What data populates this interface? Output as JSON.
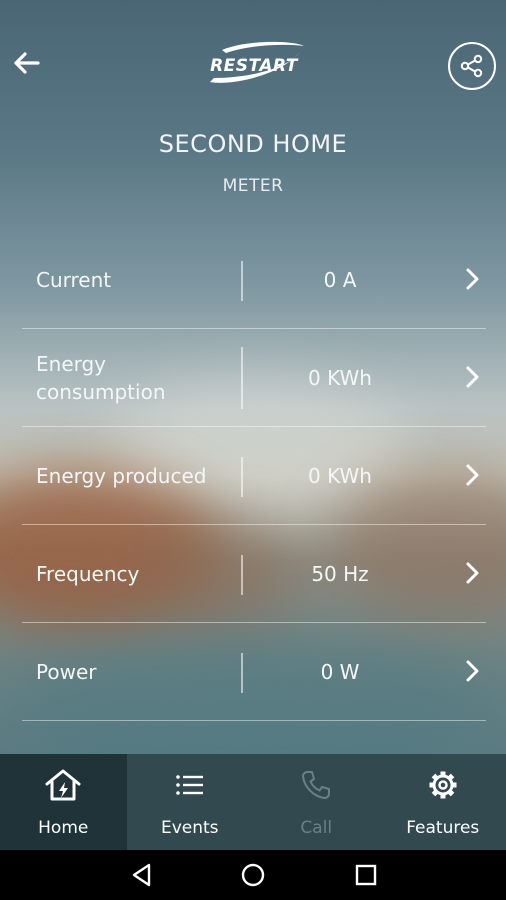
{
  "header": {
    "logo_text": "ReStart",
    "title": "SECOND HOME",
    "subtitle": "METER"
  },
  "rows": [
    {
      "label": "Current",
      "value": "0 A"
    },
    {
      "label": "Energy consumption",
      "value": "0 KWh"
    },
    {
      "label": "Energy produced",
      "value": "0 KWh"
    },
    {
      "label": "Frequency",
      "value": "50 Hz"
    },
    {
      "label": "Power",
      "value": "0 W"
    }
  ],
  "tabs": [
    {
      "label": "Home",
      "icon": "home-bolt-icon",
      "active": true
    },
    {
      "label": "Events",
      "icon": "list-icon",
      "active": false
    },
    {
      "label": "Call",
      "icon": "phone-icon",
      "active": false,
      "disabled": true
    },
    {
      "label": "Features",
      "icon": "gear-icon",
      "active": false
    }
  ],
  "colors": {
    "tabbar": "#31494f",
    "tab_active": "#1f3338",
    "tab_disabled_text": "#6b8086"
  }
}
